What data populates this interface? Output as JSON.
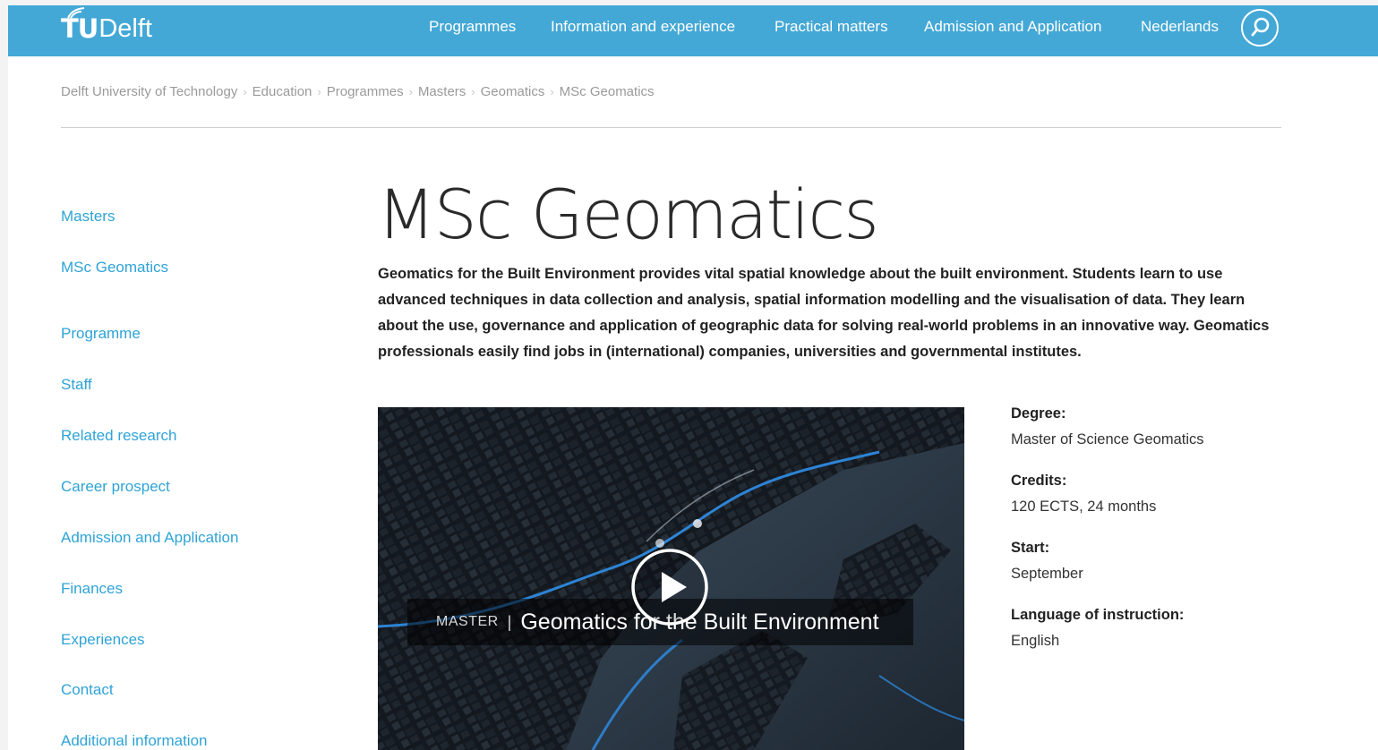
{
  "header": {
    "logo_tu": "TU",
    "logo_delft": "Delft",
    "nav": [
      {
        "label": "Programmes"
      },
      {
        "label": "Information and experience"
      },
      {
        "label": "Practical matters"
      },
      {
        "label": "Admission and Application"
      },
      {
        "label": "Nederlands"
      }
    ],
    "search_icon": "search-icon",
    "colors": {
      "bar": "#44a8d6",
      "link": "#2fa3d6"
    }
  },
  "breadcrumb": [
    "Delft University of Technology",
    "Education",
    "Programmes",
    "Masters",
    "Geomatics",
    "MSc Geomatics"
  ],
  "sidebar": {
    "items": [
      {
        "label": "Masters"
      },
      {
        "label": "MSc Geomatics"
      },
      {
        "label": "Programme"
      },
      {
        "label": "Staff"
      },
      {
        "label": "Related research"
      },
      {
        "label": "Career prospect"
      },
      {
        "label": "Admission and Application"
      },
      {
        "label": "Finances"
      },
      {
        "label": "Experiences"
      },
      {
        "label": "Contact"
      },
      {
        "label": "Additional information"
      }
    ]
  },
  "main": {
    "title": "MSc Geomatics",
    "intro": "Geomatics for the Built Environment provides vital spatial knowledge about the built environment. Students learn to use advanced techniques in data collection and analysis, spatial information modelling and the visualisation of data. They learn about the use, governance and application of geographic data for solving real-world problems in an innovative way. Geomatics professionals easily find jobs in (international) companies, universities and governmental institutes."
  },
  "video": {
    "kind": "MASTER",
    "separator": "|",
    "title": "Geomatics for the Built Environment",
    "play_icon": "play-icon"
  },
  "facts": [
    {
      "label": "Degree:",
      "value": "Master of Science Geomatics"
    },
    {
      "label": "Credits:",
      "value": "120 ECTS, 24 months"
    },
    {
      "label": "Start:",
      "value": "September"
    },
    {
      "label": "Language of instruction:",
      "value": "English"
    }
  ]
}
